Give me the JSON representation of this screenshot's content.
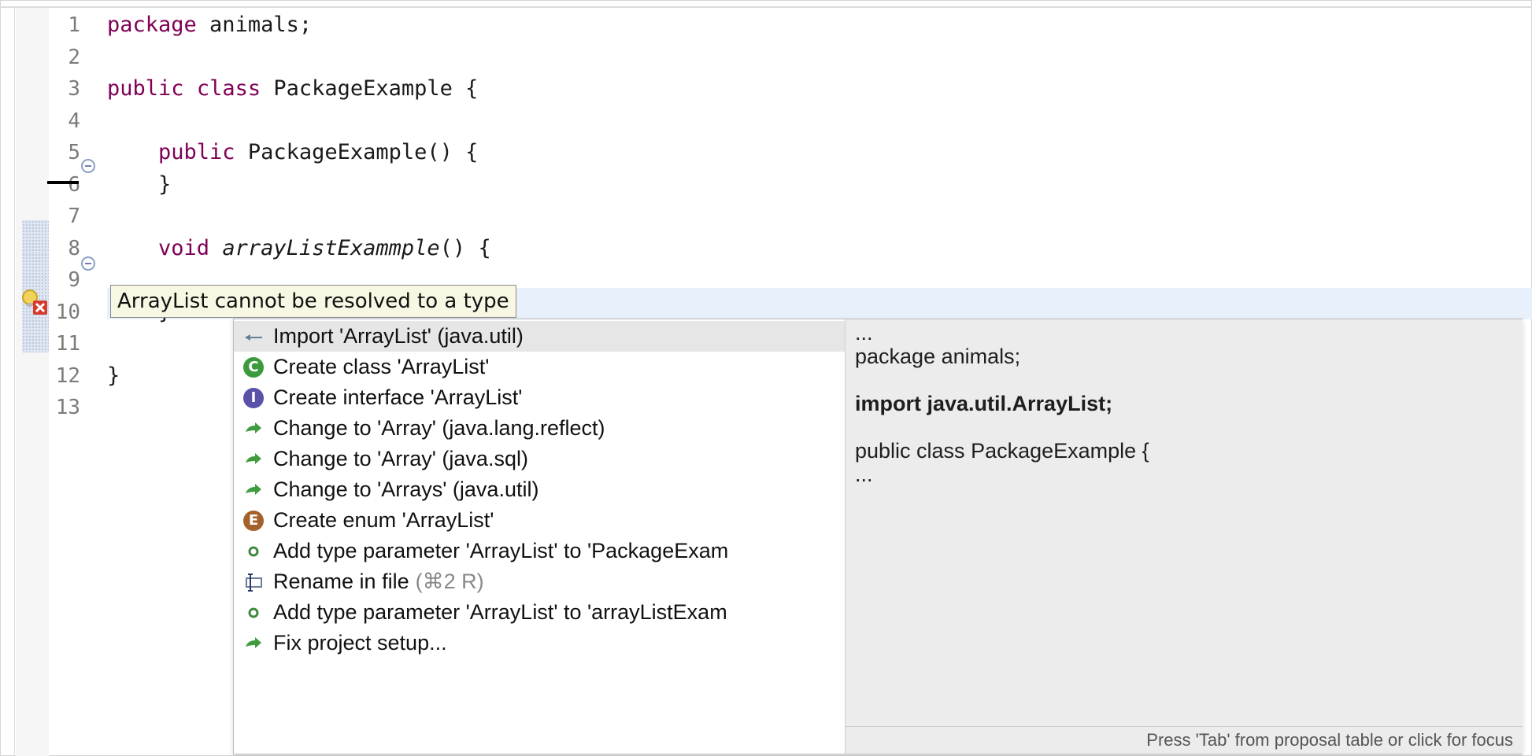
{
  "editor": {
    "lines": [
      {
        "num": "1",
        "segments": [
          {
            "t": "package",
            "kw": true
          },
          {
            "t": " animals;"
          }
        ]
      },
      {
        "num": "2",
        "segments": []
      },
      {
        "num": "3",
        "segments": [
          {
            "t": "public",
            "kw": true
          },
          {
            "t": " "
          },
          {
            "t": "class",
            "kw": true
          },
          {
            "t": " PackageExample {"
          }
        ]
      },
      {
        "num": "4",
        "segments": []
      },
      {
        "num": "5",
        "segments": [
          {
            "t": "    "
          },
          {
            "t": "public",
            "kw": true
          },
          {
            "t": " PackageExample() {"
          }
        ]
      },
      {
        "num": "6",
        "segments": [
          {
            "t": "    }"
          }
        ]
      },
      {
        "num": "7",
        "segments": []
      },
      {
        "num": "8",
        "segments": [
          {
            "t": "    "
          },
          {
            "t": "void",
            "kw": true
          },
          {
            "t": " "
          },
          {
            "t": "arrayListExammple",
            "it": true
          },
          {
            "t": "() {"
          }
        ]
      },
      {
        "num": "9",
        "segments": []
      },
      {
        "num": "10",
        "segments": [
          {
            "t": "    }"
          }
        ]
      },
      {
        "num": "11",
        "segments": []
      },
      {
        "num": "12",
        "segments": [
          {
            "t": "}"
          }
        ]
      },
      {
        "num": "13",
        "segments": []
      }
    ]
  },
  "tooltip": "ArrayList cannot be resolved to a type",
  "quickfix": {
    "items": [
      {
        "icon": "import-arrow-icon",
        "label": "Import 'ArrayList' (java.util)",
        "selected": true
      },
      {
        "icon": "class-c-icon",
        "label": "Create class 'ArrayList'"
      },
      {
        "icon": "interface-i-icon",
        "label": "Create interface 'ArrayList'"
      },
      {
        "icon": "change-arrow-icon",
        "label": "Change to 'Array' (java.lang.reflect)"
      },
      {
        "icon": "change-arrow-icon",
        "label": "Change to 'Array' (java.sql)"
      },
      {
        "icon": "change-arrow-icon",
        "label": "Change to 'Arrays' (java.util)"
      },
      {
        "icon": "enum-e-icon",
        "label": "Create enum 'ArrayList'"
      },
      {
        "icon": "type-param-dot-icon",
        "label": "Add type parameter 'ArrayList' to 'PackageExam"
      },
      {
        "icon": "rename-icon",
        "label": "Rename in file",
        "shortcut": "(⌘2 R)"
      },
      {
        "icon": "type-param-dot-icon",
        "label": "Add type parameter 'ArrayList' to 'arrayListExam"
      },
      {
        "icon": "change-arrow-icon",
        "label": "Fix project setup..."
      }
    ],
    "preview": {
      "lines": [
        {
          "text": "...",
          "bold": false
        },
        {
          "text": "package animals;",
          "bold": false
        },
        {
          "text": "import java.util.ArrayList;",
          "bold": true
        },
        {
          "text": "public class PackageExample {",
          "bold": false
        },
        {
          "text": "...",
          "bold": false
        }
      ],
      "status": "Press 'Tab' from proposal table or click for focus"
    }
  },
  "colors": {
    "keyword": "#7f0055",
    "selection": "#e6e6e6",
    "preview_bg": "#ececec",
    "tooltip_bg": "#f7f7e3"
  }
}
